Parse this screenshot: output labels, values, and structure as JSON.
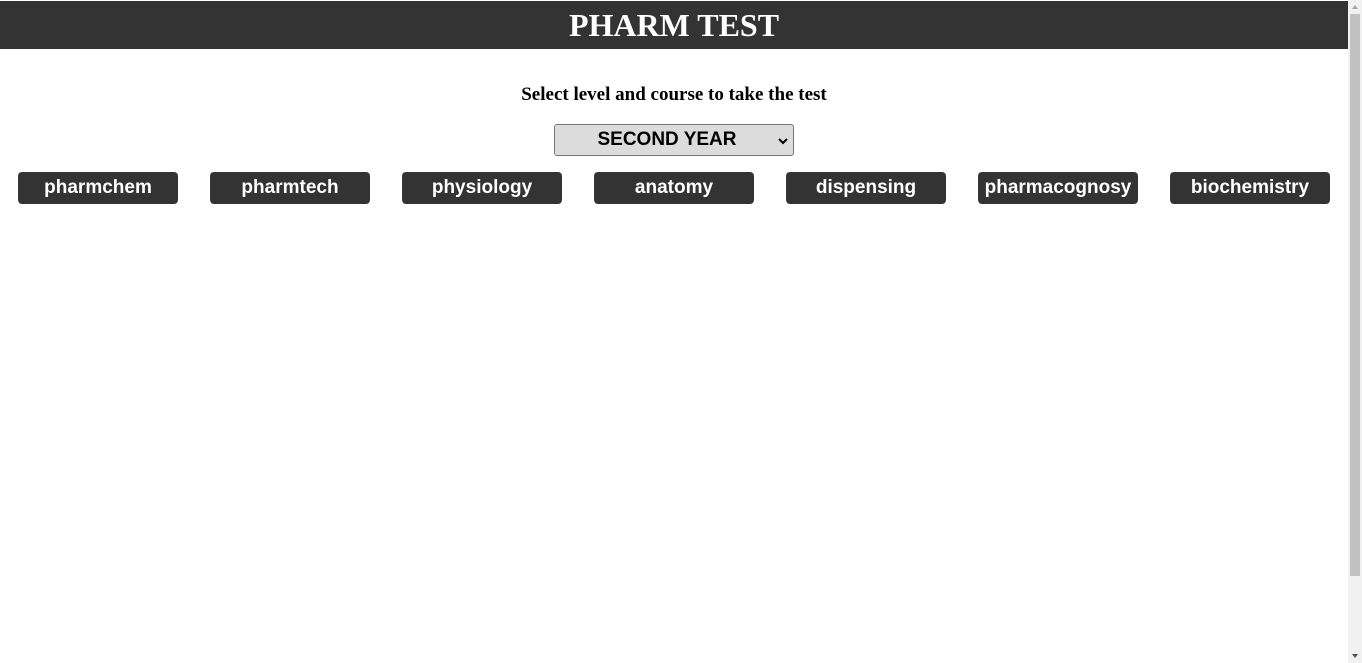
{
  "header": {
    "title": "PHARM TEST"
  },
  "instructions": "Select level and course to take the test",
  "level_select": {
    "selected": "SECOND YEAR",
    "icon": "chevron-down-icon"
  },
  "courses": [
    {
      "label": "pharmchem"
    },
    {
      "label": "pharmtech"
    },
    {
      "label": "physiology"
    },
    {
      "label": "anatomy"
    },
    {
      "label": "dispensing"
    },
    {
      "label": "pharmacognosy"
    },
    {
      "label": "biochemistry"
    }
  ],
  "colors": {
    "header_bg": "#333333",
    "button_bg": "#333333",
    "button_text": "#ffffff",
    "select_bg": "#dcdcdc"
  }
}
